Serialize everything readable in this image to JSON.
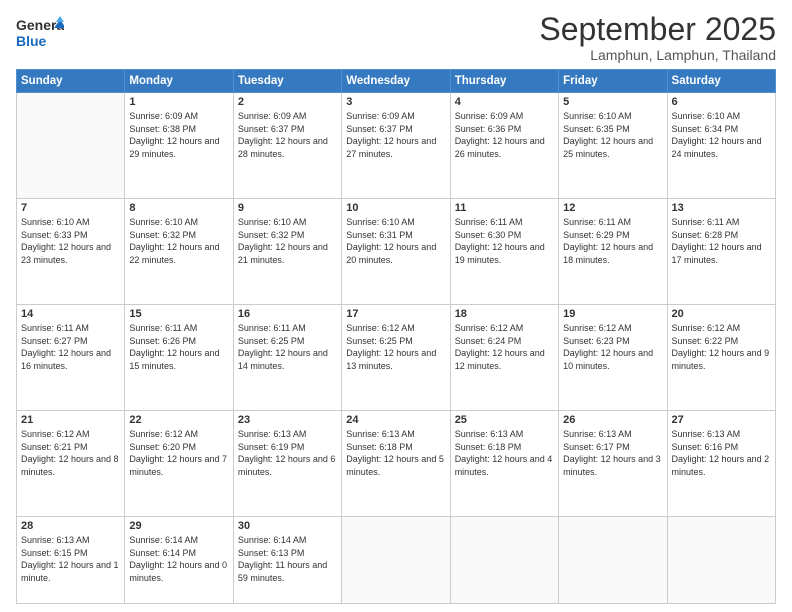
{
  "logo": {
    "general": "General",
    "blue": "Blue"
  },
  "header": {
    "month": "September 2025",
    "location": "Lamphun, Lamphun, Thailand"
  },
  "weekdays": [
    "Sunday",
    "Monday",
    "Tuesday",
    "Wednesday",
    "Thursday",
    "Friday",
    "Saturday"
  ],
  "weeks": [
    [
      {
        "day": "",
        "sunrise": "",
        "sunset": "",
        "daylight": ""
      },
      {
        "day": "1",
        "sunrise": "Sunrise: 6:09 AM",
        "sunset": "Sunset: 6:38 PM",
        "daylight": "Daylight: 12 hours and 29 minutes."
      },
      {
        "day": "2",
        "sunrise": "Sunrise: 6:09 AM",
        "sunset": "Sunset: 6:37 PM",
        "daylight": "Daylight: 12 hours and 28 minutes."
      },
      {
        "day": "3",
        "sunrise": "Sunrise: 6:09 AM",
        "sunset": "Sunset: 6:37 PM",
        "daylight": "Daylight: 12 hours and 27 minutes."
      },
      {
        "day": "4",
        "sunrise": "Sunrise: 6:09 AM",
        "sunset": "Sunset: 6:36 PM",
        "daylight": "Daylight: 12 hours and 26 minutes."
      },
      {
        "day": "5",
        "sunrise": "Sunrise: 6:10 AM",
        "sunset": "Sunset: 6:35 PM",
        "daylight": "Daylight: 12 hours and 25 minutes."
      },
      {
        "day": "6",
        "sunrise": "Sunrise: 6:10 AM",
        "sunset": "Sunset: 6:34 PM",
        "daylight": "Daylight: 12 hours and 24 minutes."
      }
    ],
    [
      {
        "day": "7",
        "sunrise": "Sunrise: 6:10 AM",
        "sunset": "Sunset: 6:33 PM",
        "daylight": "Daylight: 12 hours and 23 minutes."
      },
      {
        "day": "8",
        "sunrise": "Sunrise: 6:10 AM",
        "sunset": "Sunset: 6:32 PM",
        "daylight": "Daylight: 12 hours and 22 minutes."
      },
      {
        "day": "9",
        "sunrise": "Sunrise: 6:10 AM",
        "sunset": "Sunset: 6:32 PM",
        "daylight": "Daylight: 12 hours and 21 minutes."
      },
      {
        "day": "10",
        "sunrise": "Sunrise: 6:10 AM",
        "sunset": "Sunset: 6:31 PM",
        "daylight": "Daylight: 12 hours and 20 minutes."
      },
      {
        "day": "11",
        "sunrise": "Sunrise: 6:11 AM",
        "sunset": "Sunset: 6:30 PM",
        "daylight": "Daylight: 12 hours and 19 minutes."
      },
      {
        "day": "12",
        "sunrise": "Sunrise: 6:11 AM",
        "sunset": "Sunset: 6:29 PM",
        "daylight": "Daylight: 12 hours and 18 minutes."
      },
      {
        "day": "13",
        "sunrise": "Sunrise: 6:11 AM",
        "sunset": "Sunset: 6:28 PM",
        "daylight": "Daylight: 12 hours and 17 minutes."
      }
    ],
    [
      {
        "day": "14",
        "sunrise": "Sunrise: 6:11 AM",
        "sunset": "Sunset: 6:27 PM",
        "daylight": "Daylight: 12 hours and 16 minutes."
      },
      {
        "day": "15",
        "sunrise": "Sunrise: 6:11 AM",
        "sunset": "Sunset: 6:26 PM",
        "daylight": "Daylight: 12 hours and 15 minutes."
      },
      {
        "day": "16",
        "sunrise": "Sunrise: 6:11 AM",
        "sunset": "Sunset: 6:25 PM",
        "daylight": "Daylight: 12 hours and 14 minutes."
      },
      {
        "day": "17",
        "sunrise": "Sunrise: 6:12 AM",
        "sunset": "Sunset: 6:25 PM",
        "daylight": "Daylight: 12 hours and 13 minutes."
      },
      {
        "day": "18",
        "sunrise": "Sunrise: 6:12 AM",
        "sunset": "Sunset: 6:24 PM",
        "daylight": "Daylight: 12 hours and 12 minutes."
      },
      {
        "day": "19",
        "sunrise": "Sunrise: 6:12 AM",
        "sunset": "Sunset: 6:23 PM",
        "daylight": "Daylight: 12 hours and 10 minutes."
      },
      {
        "day": "20",
        "sunrise": "Sunrise: 6:12 AM",
        "sunset": "Sunset: 6:22 PM",
        "daylight": "Daylight: 12 hours and 9 minutes."
      }
    ],
    [
      {
        "day": "21",
        "sunrise": "Sunrise: 6:12 AM",
        "sunset": "Sunset: 6:21 PM",
        "daylight": "Daylight: 12 hours and 8 minutes."
      },
      {
        "day": "22",
        "sunrise": "Sunrise: 6:12 AM",
        "sunset": "Sunset: 6:20 PM",
        "daylight": "Daylight: 12 hours and 7 minutes."
      },
      {
        "day": "23",
        "sunrise": "Sunrise: 6:13 AM",
        "sunset": "Sunset: 6:19 PM",
        "daylight": "Daylight: 12 hours and 6 minutes."
      },
      {
        "day": "24",
        "sunrise": "Sunrise: 6:13 AM",
        "sunset": "Sunset: 6:18 PM",
        "daylight": "Daylight: 12 hours and 5 minutes."
      },
      {
        "day": "25",
        "sunrise": "Sunrise: 6:13 AM",
        "sunset": "Sunset: 6:18 PM",
        "daylight": "Daylight: 12 hours and 4 minutes."
      },
      {
        "day": "26",
        "sunrise": "Sunrise: 6:13 AM",
        "sunset": "Sunset: 6:17 PM",
        "daylight": "Daylight: 12 hours and 3 minutes."
      },
      {
        "day": "27",
        "sunrise": "Sunrise: 6:13 AM",
        "sunset": "Sunset: 6:16 PM",
        "daylight": "Daylight: 12 hours and 2 minutes."
      }
    ],
    [
      {
        "day": "28",
        "sunrise": "Sunrise: 6:13 AM",
        "sunset": "Sunset: 6:15 PM",
        "daylight": "Daylight: 12 hours and 1 minute."
      },
      {
        "day": "29",
        "sunrise": "Sunrise: 6:14 AM",
        "sunset": "Sunset: 6:14 PM",
        "daylight": "Daylight: 12 hours and 0 minutes."
      },
      {
        "day": "30",
        "sunrise": "Sunrise: 6:14 AM",
        "sunset": "Sunset: 6:13 PM",
        "daylight": "Daylight: 11 hours and 59 minutes."
      },
      {
        "day": "",
        "sunrise": "",
        "sunset": "",
        "daylight": ""
      },
      {
        "day": "",
        "sunrise": "",
        "sunset": "",
        "daylight": ""
      },
      {
        "day": "",
        "sunrise": "",
        "sunset": "",
        "daylight": ""
      },
      {
        "day": "",
        "sunrise": "",
        "sunset": "",
        "daylight": ""
      }
    ]
  ]
}
